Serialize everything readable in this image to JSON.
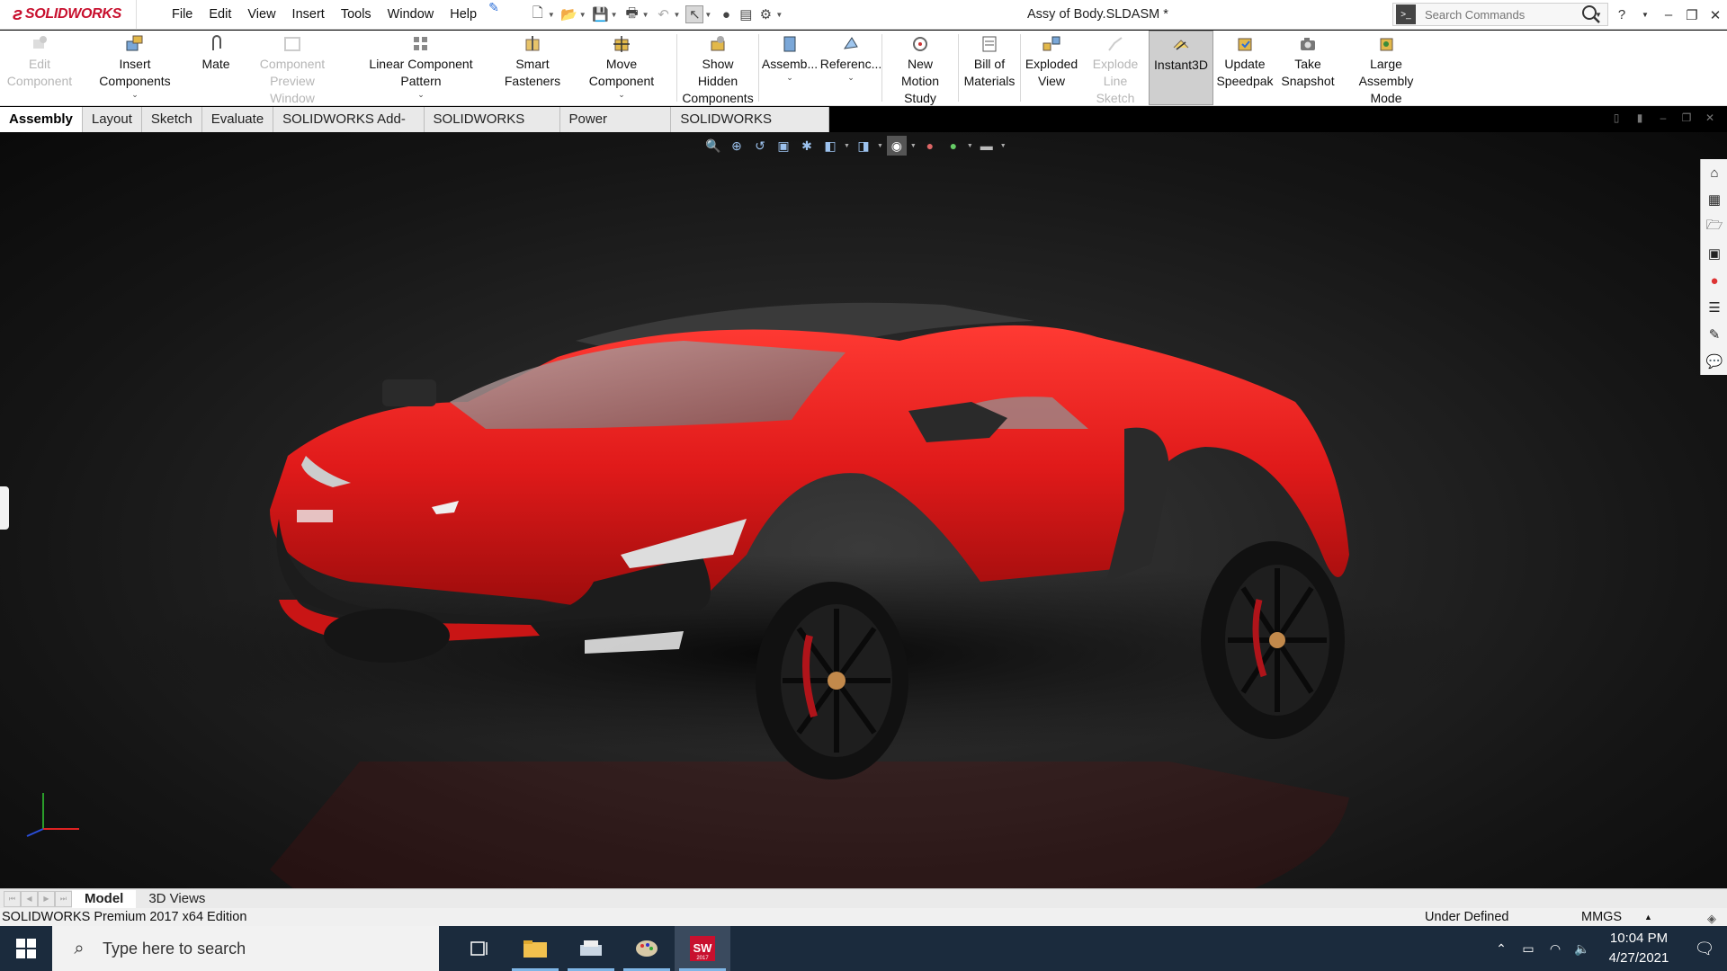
{
  "app": {
    "brand": "SOLIDWORKS",
    "document_title": "Assy of Body.SLDASM *"
  },
  "menu": [
    "File",
    "Edit",
    "View",
    "Insert",
    "Tools",
    "Window",
    "Help"
  ],
  "search": {
    "placeholder": "Search Commands"
  },
  "command_manager": {
    "edit_component": [
      "Edit",
      "Component"
    ],
    "insert_components": "Insert Components",
    "mate": "Mate",
    "component_preview": [
      "Component",
      "Preview Window"
    ],
    "linear_pattern": "Linear Component Pattern",
    "smart_fasteners": [
      "Smart",
      "Fasteners"
    ],
    "move_component": "Move Component",
    "show_hidden": [
      "Show Hidden",
      "Components"
    ],
    "assembly": "Assemb...",
    "reference": "Referenc...",
    "new_motion_study": [
      "New Motion",
      "Study"
    ],
    "bill_of_materials": [
      "Bill of",
      "Materials"
    ],
    "exploded_view": [
      "Exploded",
      "View"
    ],
    "explode_line_sketch": [
      "Explode",
      "Line Sketch"
    ],
    "instant3d": "Instant3D",
    "update_speedpak": [
      "Update",
      "Speedpak"
    ],
    "take_snapshot": [
      "Take",
      "Snapshot"
    ],
    "large_assembly": [
      "Large Assembly",
      "Mode"
    ]
  },
  "tabs": [
    "Assembly",
    "Layout",
    "Sketch",
    "Evaluate",
    "SOLIDWORKS Add-Ins",
    "SOLIDWORKS MBD",
    "Power Surfacing",
    "SOLIDWORKS Visualize"
  ],
  "active_tab": "Assembly",
  "model_tabs": [
    "Model",
    "3D Views"
  ],
  "status": {
    "edition": "SOLIDWORKS Premium 2017 x64 Edition",
    "state": "Under Defined",
    "units": "MMGS"
  },
  "taskbar": {
    "search_placeholder": "Type here to search",
    "time": "10:04 PM",
    "date": "4/27/2021",
    "sw_badge": "SW",
    "sw_year": "2017"
  },
  "colors": {
    "brand_red": "#c8102e",
    "car_red": "#e41e1e",
    "taskbar": "#1b2b3d"
  }
}
